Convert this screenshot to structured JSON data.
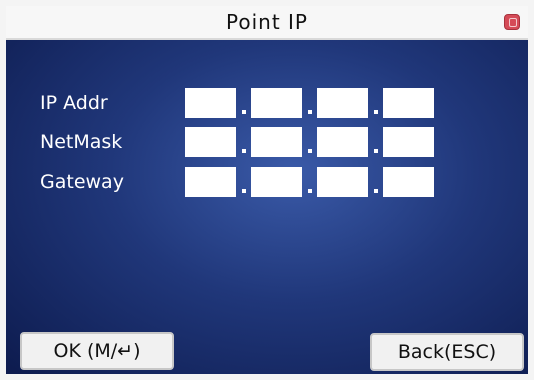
{
  "window": {
    "title": "Point IP",
    "close_icon": "close-icon",
    "accent_close": "#d54b57",
    "background_top": "#3a5aa8",
    "background_bottom": "#0d1b4e"
  },
  "fields": [
    {
      "label": "IP Addr",
      "octets": [
        "",
        "",
        "",
        ""
      ]
    },
    {
      "label": "NetMask",
      "octets": [
        "",
        "",
        "",
        ""
      ]
    },
    {
      "label": "Gateway",
      "octets": [
        "",
        "",
        "",
        ""
      ]
    }
  ],
  "softkeys": {
    "ok_label": "OK (M/↵)",
    "back_label": "Back(ESC)"
  }
}
